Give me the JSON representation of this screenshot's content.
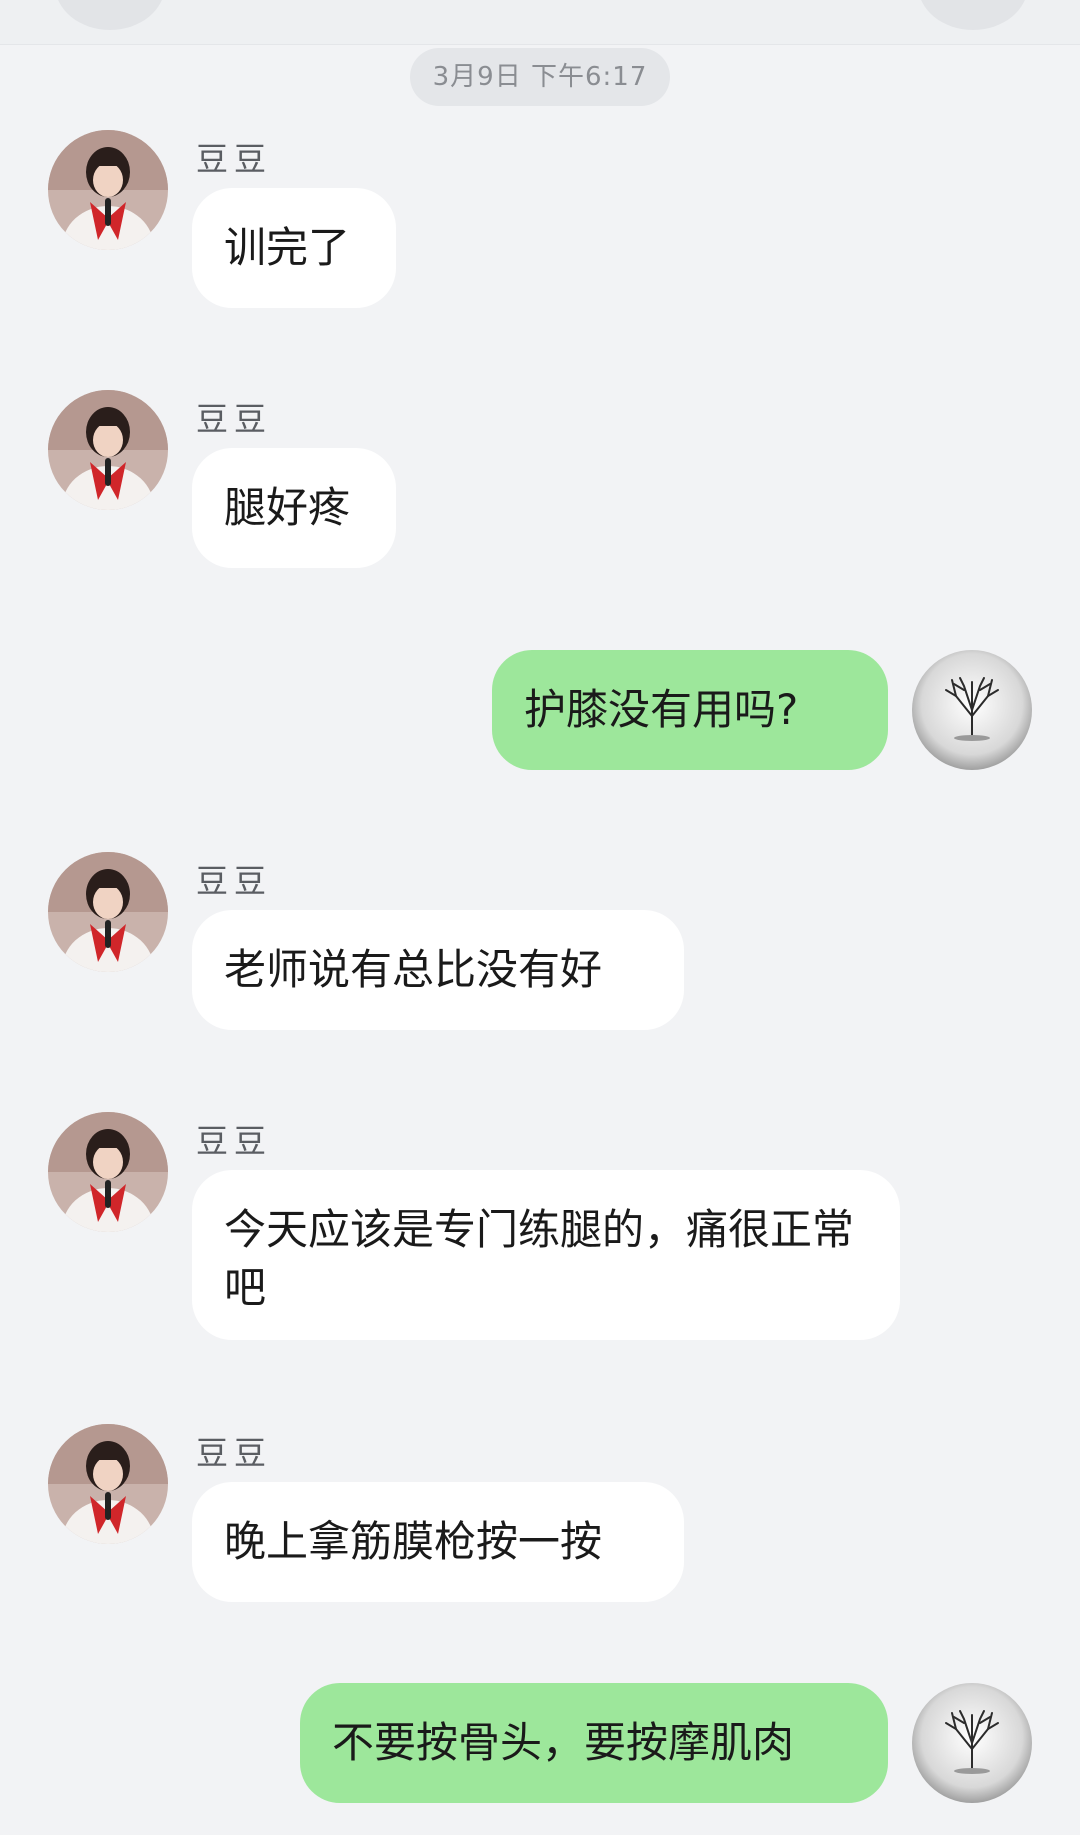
{
  "timestamp": "3月9日 下午6:17",
  "colors": {
    "background": "#f2f3f5",
    "incoming_bubble": "#ffffff",
    "outgoing_bubble": "#9de79b",
    "timestamp_pill": "#e4e6e9"
  },
  "contact": {
    "name": "豆豆",
    "avatar_icon": "girl-portrait-avatar"
  },
  "self": {
    "avatar_icon": "bare-tree-avatar"
  },
  "messages": [
    {
      "from": "contact",
      "sender": "豆豆",
      "text": "训完了"
    },
    {
      "from": "contact",
      "sender": "豆豆",
      "text": "腿好疼"
    },
    {
      "from": "self",
      "text": "护膝没有用吗?"
    },
    {
      "from": "contact",
      "sender": "豆豆",
      "text": "老师说有总比没有好"
    },
    {
      "from": "contact",
      "sender": "豆豆",
      "text": "今天应该是专门练腿的，痛很正常吧"
    },
    {
      "from": "contact",
      "sender": "豆豆",
      "text": "晚上拿筋膜枪按一按"
    },
    {
      "from": "self",
      "text": "不要按骨头，要按摩肌肉"
    }
  ]
}
